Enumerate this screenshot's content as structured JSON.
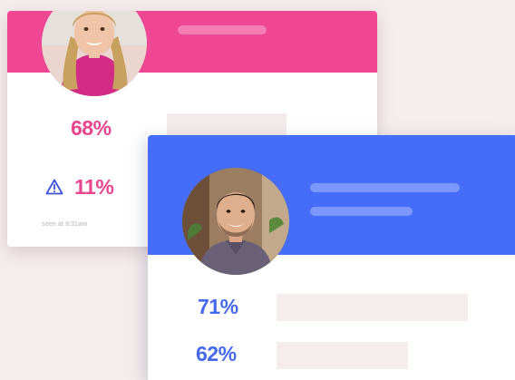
{
  "colors": {
    "background": "#f5ecec",
    "pink_accent": "#ef4794",
    "pink_text": "#e8458f",
    "blue_accent": "#456df7",
    "blue_text": "#4668ec"
  },
  "card_pink": {
    "stat_primary": "68%",
    "stat_warning": "11%",
    "warning_icon": "warning-triangle-icon",
    "seen_text": "seen at 9:31am"
  },
  "card_blue": {
    "stat_primary": "71%",
    "stat_secondary": "62%"
  }
}
